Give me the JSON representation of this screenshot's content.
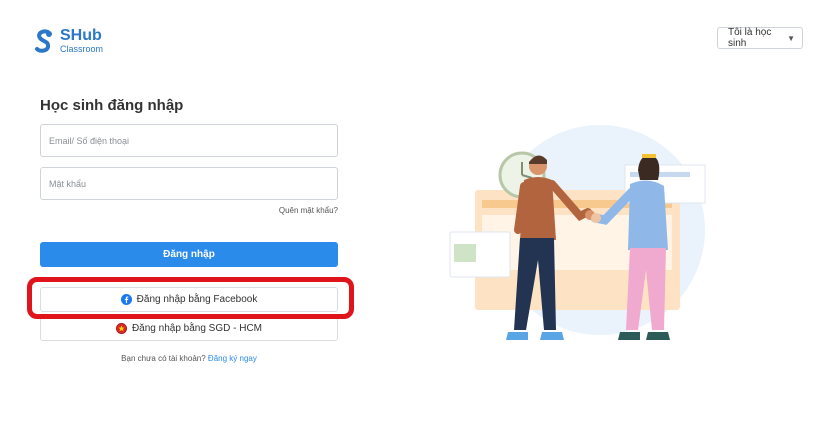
{
  "brand": {
    "name": "SHub",
    "sub": "Classroom",
    "color": "#2b77c8"
  },
  "role_select": {
    "value": "Tôi là học sinh",
    "icon": "caret-down-icon"
  },
  "form": {
    "title": "Học sinh đăng nhập",
    "email_placeholder": "Email/ Số điện thoại",
    "password_placeholder": "Mật khẩu",
    "forgot_label": "Quên mật khẩu?",
    "login_label": "Đăng nhập",
    "facebook_label": "Đăng nhập bằng Facebook",
    "sgd_label": "Đăng nhập bằng SGD - HCM",
    "signup_prompt": "Bạn chưa có tài khoản?",
    "signup_link": "Đăng ký ngay"
  },
  "colors": {
    "primary": "#2b8bea",
    "highlight": "#e0141b",
    "facebook": "#1877f2"
  }
}
